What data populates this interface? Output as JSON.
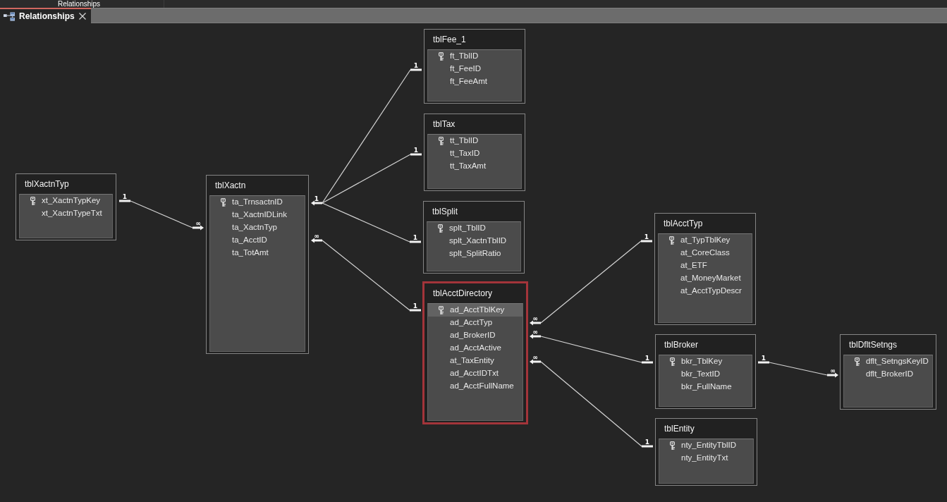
{
  "title_bar": {
    "label": "Relationships"
  },
  "tabs": [
    {
      "label": "Relationships",
      "selected": true
    }
  ],
  "tables": [
    {
      "title": "tblXactnTyp",
      "selected": false,
      "fields": [
        {
          "name": "xt_XactnTypKey",
          "key": true,
          "selected": false
        },
        {
          "name": "xt_XactnTypeTxt",
          "key": false,
          "selected": false
        }
      ]
    },
    {
      "title": "tblXactn",
      "selected": false,
      "fields": [
        {
          "name": "ta_TrnsactnID",
          "key": true,
          "selected": false
        },
        {
          "name": "ta_XactnIDLink",
          "key": false,
          "selected": false
        },
        {
          "name": "ta_XactnTyp",
          "key": false,
          "selected": false
        },
        {
          "name": "ta_AcctID",
          "key": false,
          "selected": false
        },
        {
          "name": "ta_TotAmt",
          "key": false,
          "selected": false
        }
      ]
    },
    {
      "title": "tblFee_1",
      "selected": false,
      "fields": [
        {
          "name": "ft_TblID",
          "key": true,
          "selected": false
        },
        {
          "name": "ft_FeeID",
          "key": false,
          "selected": false
        },
        {
          "name": "ft_FeeAmt",
          "key": false,
          "selected": false
        }
      ]
    },
    {
      "title": "tblTax",
      "selected": false,
      "fields": [
        {
          "name": "tt_TblID",
          "key": true,
          "selected": false
        },
        {
          "name": "tt_TaxID",
          "key": false,
          "selected": false
        },
        {
          "name": "tt_TaxAmt",
          "key": false,
          "selected": false
        }
      ]
    },
    {
      "title": "tblSplit",
      "selected": false,
      "fields": [
        {
          "name": "splt_TblID",
          "key": true,
          "selected": false
        },
        {
          "name": "splt_XactnTblID",
          "key": false,
          "selected": false
        },
        {
          "name": "splt_SplitRatio",
          "key": false,
          "selected": false
        }
      ]
    },
    {
      "title": "tblAcctDirectory",
      "selected": true,
      "fields": [
        {
          "name": "ad_AcctTblKey",
          "key": true,
          "selected": true
        },
        {
          "name": "ad_AcctTyp",
          "key": false,
          "selected": false
        },
        {
          "name": "ad_BrokerID",
          "key": false,
          "selected": false
        },
        {
          "name": "ad_AcctActive",
          "key": false,
          "selected": false
        },
        {
          "name": "at_TaxEntity",
          "key": false,
          "selected": false
        },
        {
          "name": "ad_AcctIDTxt",
          "key": false,
          "selected": false
        },
        {
          "name": "ad_AcctFullName",
          "key": false,
          "selected": false
        }
      ]
    },
    {
      "title": "tblAcctTyp",
      "selected": false,
      "fields": [
        {
          "name": "at_TypTblKey",
          "key": true,
          "selected": false
        },
        {
          "name": "at_CoreClass",
          "key": false,
          "selected": false
        },
        {
          "name": "at_ETF",
          "key": false,
          "selected": false
        },
        {
          "name": "at_MoneyMarket",
          "key": false,
          "selected": false
        },
        {
          "name": "at_AcctTypDescr",
          "key": false,
          "selected": false
        }
      ]
    },
    {
      "title": "tblBroker",
      "selected": false,
      "fields": [
        {
          "name": "bkr_TblKey",
          "key": true,
          "selected": false
        },
        {
          "name": "bkr_TextID",
          "key": false,
          "selected": false
        },
        {
          "name": "bkr_FullName",
          "key": false,
          "selected": false
        }
      ]
    },
    {
      "title": "tblEntity",
      "selected": false,
      "fields": [
        {
          "name": "nty_EntityTblID",
          "key": true,
          "selected": false
        },
        {
          "name": "nty_EntityTxt",
          "key": false,
          "selected": false
        }
      ]
    },
    {
      "title": "tblDfltSetngs",
      "selected": false,
      "fields": [
        {
          "name": "dflt_SetngsKeyID",
          "key": true,
          "selected": false
        },
        {
          "name": "dflt_BrokerID",
          "key": false,
          "selected": false
        }
      ]
    }
  ],
  "relationships": [
    {
      "from": {
        "label": "1",
        "arrow": false
      },
      "to": [
        {
          "label": "∞",
          "arrow": true
        }
      ]
    },
    {
      "from": {
        "label": "1",
        "arrow": true
      },
      "to": [
        {
          "label": "1",
          "arrow": false
        },
        {
          "label": "1",
          "arrow": false
        },
        {
          "label": "1",
          "arrow": false
        }
      ]
    },
    {
      "from": {
        "label": "∞",
        "arrow": true
      },
      "to": [
        {
          "label": "1",
          "arrow": false
        }
      ]
    },
    {
      "from": {
        "label": "∞",
        "arrow": true
      },
      "to": [
        {
          "label": "1",
          "arrow": false
        }
      ]
    },
    {
      "from": {
        "label": "∞",
        "arrow": true
      },
      "to": [
        {
          "label": "1",
          "arrow": false
        }
      ]
    },
    {
      "from": {
        "label": "∞",
        "arrow": true
      },
      "to": [
        {
          "label": "1",
          "arrow": false
        }
      ]
    },
    {
      "from": {
        "label": "1",
        "arrow": false
      },
      "to": [
        {
          "label": "∞",
          "arrow": true
        }
      ]
    }
  ]
}
